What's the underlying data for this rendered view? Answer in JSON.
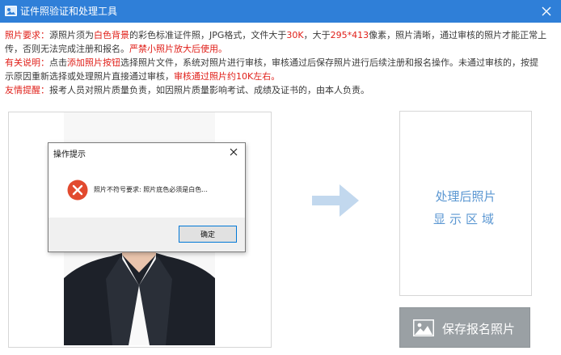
{
  "window": {
    "title": "证件照验证和处理工具"
  },
  "notes": {
    "req": {
      "label": "照片要求：",
      "t1": "源照片须为",
      "h1": "白色背景",
      "t2": "的彩色标准证件照，JPG格式，文件大于",
      "h2": "30K",
      "t3": "，大于",
      "h3": "295*413",
      "t4": "像素，照片清晰，通过审核的照片才能正常上",
      "cont": "传，否则无法完成注册和报名。",
      "h4": "严禁小照片放大后使用。"
    },
    "info": {
      "label": "有关说明：",
      "t1": "点击",
      "h1": "添加照片按钮",
      "t2": "选择照片文件，系统对照片进行审核，审核通过后保存照片进行后续注册和报名操作。未通过审核的，按提",
      "cont": "示原因重新选择或处理照片直接通过审核，",
      "h2": "审核通过照片约10K左右。"
    },
    "tip": {
      "label": "友情提醒：",
      "t1": "报考人员对照片质量负责，如因照片质量影响考试、成绩及证书的，由本人负责。"
    }
  },
  "result_panel": {
    "line1": "处理后照片",
    "line2": "显示区域"
  },
  "save_button": {
    "label": "保存报名照片"
  },
  "dialog": {
    "title": "操作提示",
    "message": "照片不符号要求: 照片底色必须是白色...",
    "ok_label": "确定"
  },
  "colors": {
    "titlebar": "#2f7fd8",
    "highlight": "#e0201a",
    "panel_text": "#5b97d2",
    "arrow": "#c2d8ee",
    "error": "#e24a2f"
  }
}
